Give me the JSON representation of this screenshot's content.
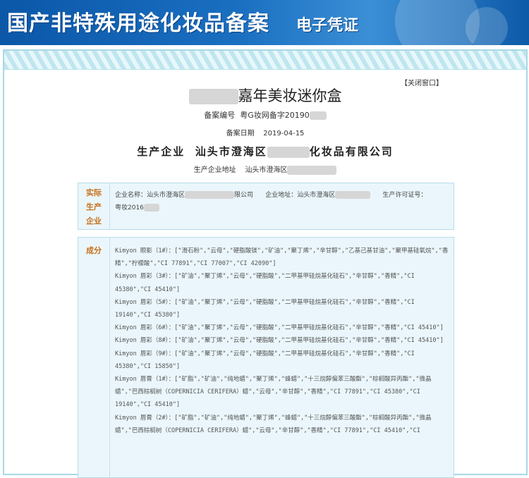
{
  "banner": {
    "title": "国产非特殊用途化妆品备案",
    "subtitle": "电子凭证"
  },
  "close_label": "【关闭窗口】",
  "product_name_suffix": "嘉年美妆迷你盒",
  "record_no": {
    "label": "备案编号",
    "value": "粤G妆网备字20190"
  },
  "record_date": {
    "label": "备案日期",
    "value": "2019-04-15"
  },
  "producer": {
    "label": "生产企业",
    "name_prefix": "汕头市澄海区",
    "name_suffix": "化妆品有限公司"
  },
  "producer_addr": {
    "label": "生产企业地址",
    "value": "汕头市澄海区"
  },
  "actual_producer": {
    "label_lines": [
      "实际",
      "生产",
      "企业"
    ],
    "company_label": "企业名称：",
    "company_prefix": "汕头市澄海区",
    "company_suffix": "限公司",
    "address_label": "企业地址：",
    "address_prefix": "汕头市澄海区",
    "license_label": "生产许可证号：",
    "license_prefix": "粤妆2016"
  },
  "ingredients": {
    "label": "成分",
    "items": [
      "Kimyon 眼影（1#）：[\"滑石粉\",\"云母\",\"硬脂酸镁\",\"矿油\",\"聚丁烯\",\"辛甘醇\",\"乙基己基甘油\",\"聚甲基硅氧烷\",\"香精\",\"柠檬酸\",\"CI 77891\",\"CI 77007\",\"CI 42090\"]",
      "Kimyon 唇彩（3#）：[\"矿油\",\"聚丁烯\",\"云母\",\"硬脂酸\",\"二甲基甲硅烷基化硅石\",\"辛甘醇\",\"香精\",\"CI 45380\",\"CI 45410\"]",
      "Kimyon 唇彩（5#）：[\"矿油\",\"聚丁烯\",\"云母\",\"硬脂酸\",\"二甲基甲硅烷基化硅石\",\"辛甘醇\",\"香精\",\"CI 19140\",\"CI 45380\"]",
      "Kimyon 唇彩（6#）：[\"矿油\",\"聚丁烯\",\"云母\",\"硬脂酸\",\"二甲基甲硅烷基化硅石\",\"辛甘醇\",\"香精\",\"CI 45410\"]",
      "Kimyon 唇彩（8#）：[\"矿油\",\"聚丁烯\",\"云母\",\"硬脂酸\",\"二甲基甲硅烷基化硅石\",\"辛甘醇\",\"香精\",\"CI 45410\"]",
      "Kimyon 唇彩（9#）：[\"矿油\",\"聚丁烯\",\"云母\",\"硬脂酸\",\"二甲基甲硅烷基化硅石\",\"辛甘醇\",\"香精\",\"CI 45380\",\"CI 15850\"]",
      "Kimyon 唇膏（1#）：[\"矿脂\",\"矿油\",\"纯地蜡\",\"聚丁烯\",\"蜂蜡\",\"十三烷醇偏苯三酸酯\",\"棕榈酸异丙酯\",\"微晶蜡\",\"巴西棕榈树（COPERNICIA CERIFERA）蜡\",\"云母\",\"辛甘醇\",\"香精\",\"CI 77891\",\"CI 45380\",\"CI 19140\",\"CI 45410\"]",
      "Kimyon 唇膏（2#）：[\"矿脂\",\"矿油\",\"纯地蜡\",\"聚丁烯\",\"蜂蜡\",\"十三烷醇偏苯三酸酯\",\"棕榈酸异丙酯\",\"微晶蜡\",\"巴西棕榈树（COPERNICIA CERIFERA）蜡\",\"云母\",\"辛甘醇\",\"香精\",\"CI 77891\",\"CI 45410\",\"CI"
    ]
  }
}
